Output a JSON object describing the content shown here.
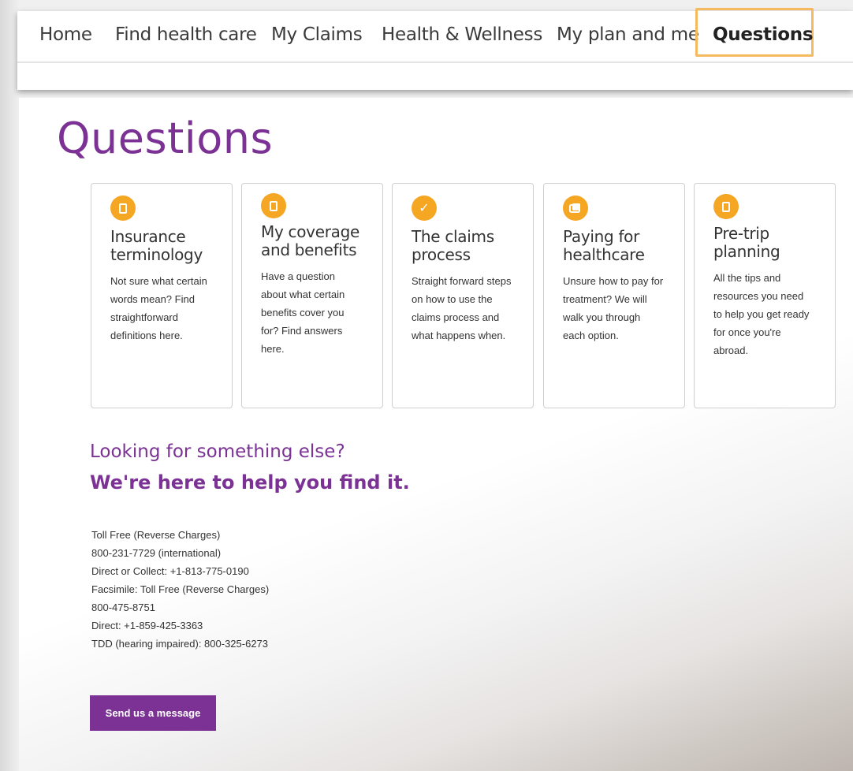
{
  "nav": {
    "items": [
      {
        "label": "Home",
        "active": false
      },
      {
        "label": "Find health care",
        "active": false
      },
      {
        "label": "My Claims",
        "active": false
      },
      {
        "label": "Health & Wellness",
        "active": false
      },
      {
        "label": "My plan and me",
        "active": false
      },
      {
        "label": "Questions",
        "active": true
      }
    ],
    "highlight_color": "#f5b95f"
  },
  "page": {
    "title": "Questions"
  },
  "cards": [
    {
      "icon": "document-icon",
      "title": "Insurance terminology",
      "description": "Not sure what certain words mean? Find straightforward definitions here."
    },
    {
      "icon": "document-icon",
      "title": "My coverage and benefits",
      "description": "Have a question about what certain benefits cover you for? Find answers here."
    },
    {
      "icon": "checkmark-icon",
      "title": "The claims process",
      "description": "Straight forward steps on how to use the claims process and what happens when."
    },
    {
      "icon": "wallet-icon",
      "title": "Paying for healthcare",
      "description": "Unsure how to pay for treatment? We will walk you through each option."
    },
    {
      "icon": "document-icon",
      "title": "Pre-trip planning",
      "description": "All the tips and resources you need to help you get ready for once you're abroad."
    }
  ],
  "help": {
    "line1": "Looking for something else?",
    "line2": "We're here to help you find it.",
    "contacts": [
      "Toll Free (Reverse Charges)",
      "800-231-7729 (international)",
      "Direct or Collect: +1-813-775-0190",
      "Facsimile: Toll Free (Reverse Charges)",
      "800-475-8751",
      "Direct: +1-859-425-3363",
      "TDD (hearing impaired): 800-325-6273"
    ],
    "button_label": "Send us a message"
  },
  "colors": {
    "brand_purple": "#7b3294",
    "icon_orange": "#f5a623"
  }
}
